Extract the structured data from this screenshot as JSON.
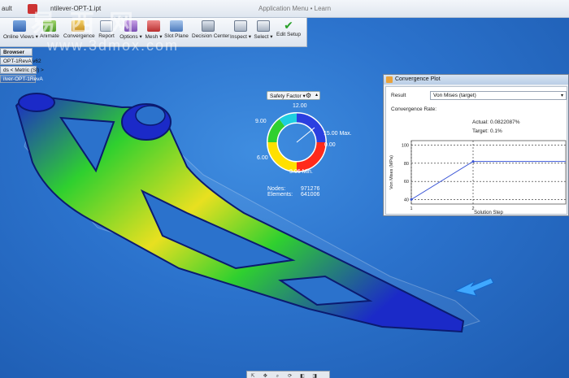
{
  "titlebar": {
    "left_text": "ault",
    "doc_name": "ntilever-OPT-1.ipt",
    "right_text": "Application Menu • Learn"
  },
  "watermark": {
    "chars": "易西网",
    "url": "www.3dmox.com"
  },
  "ribbon": {
    "items": [
      {
        "label": "Online Views ▾",
        "icon": "views-icon"
      },
      {
        "label": "Animate",
        "icon": "animate-icon"
      },
      {
        "label": "Convergence",
        "icon": "convergence-icon"
      },
      {
        "label": "Report",
        "icon": "report-icon"
      },
      {
        "label": "Options ▾",
        "icon": "options-icon"
      },
      {
        "label": "Mesh ▾",
        "icon": "mesh-icon"
      },
      {
        "label": "Slot Plane",
        "icon": "slot-plane-icon"
      },
      {
        "label": "Decision Center",
        "icon": "decision-center-icon"
      },
      {
        "label": "Inspect ▾",
        "icon": "inspect-icon"
      },
      {
        "label": "Select ▾",
        "icon": "select-icon"
      },
      {
        "label": "Edit Setup",
        "icon": "checkmark-icon"
      }
    ]
  },
  "browser": {
    "header": "Browser",
    "rows": [
      "OPT-1RevA v62",
      "ds < Metric (SI) >",
      "ilver-OPT-1RevA"
    ]
  },
  "legend": {
    "dropdown_label": "Safety Factor ▾",
    "ticks": {
      "t12": "12.00",
      "t9": "9.00",
      "t15": "15.00 Max.",
      "t0": "0.00",
      "t6": "6.00",
      "t3": "3.06 Min."
    },
    "nodes_label": "Nodes:",
    "nodes_value": "971276",
    "elements_label": "Elements:",
    "elements_value": "641006",
    "colors": [
      "#ff2a1a",
      "#ffe000",
      "#2fd02f",
      "#1ecfe0",
      "#2b3fe0"
    ]
  },
  "convergence": {
    "title": "Convergence Plot",
    "result_label": "Result",
    "result_value": "Von Mises (target)",
    "rate_label": "Convergence Rate:",
    "actual_label": "Actual:",
    "actual_value": "0.0822087%",
    "target_label": "Target:",
    "target_value": "0.1%"
  },
  "chart_data": {
    "type": "line",
    "xlabel": "Solution Step",
    "ylabel": "Von Mises (MPa)",
    "x_ticks": [
      "1",
      "2"
    ],
    "y_ticks": [
      "40",
      "60",
      "80",
      "100"
    ],
    "ylim": [
      35,
      105
    ],
    "xlim": [
      1,
      3.5
    ],
    "series": [
      {
        "x": [
          1,
          2,
          3.5
        ],
        "y": [
          40,
          82,
          82
        ]
      }
    ],
    "grid": true
  },
  "navbar": {
    "icons": [
      "⇱",
      "✥",
      "⌕",
      "⟳",
      "◧",
      "◨",
      "■"
    ]
  }
}
